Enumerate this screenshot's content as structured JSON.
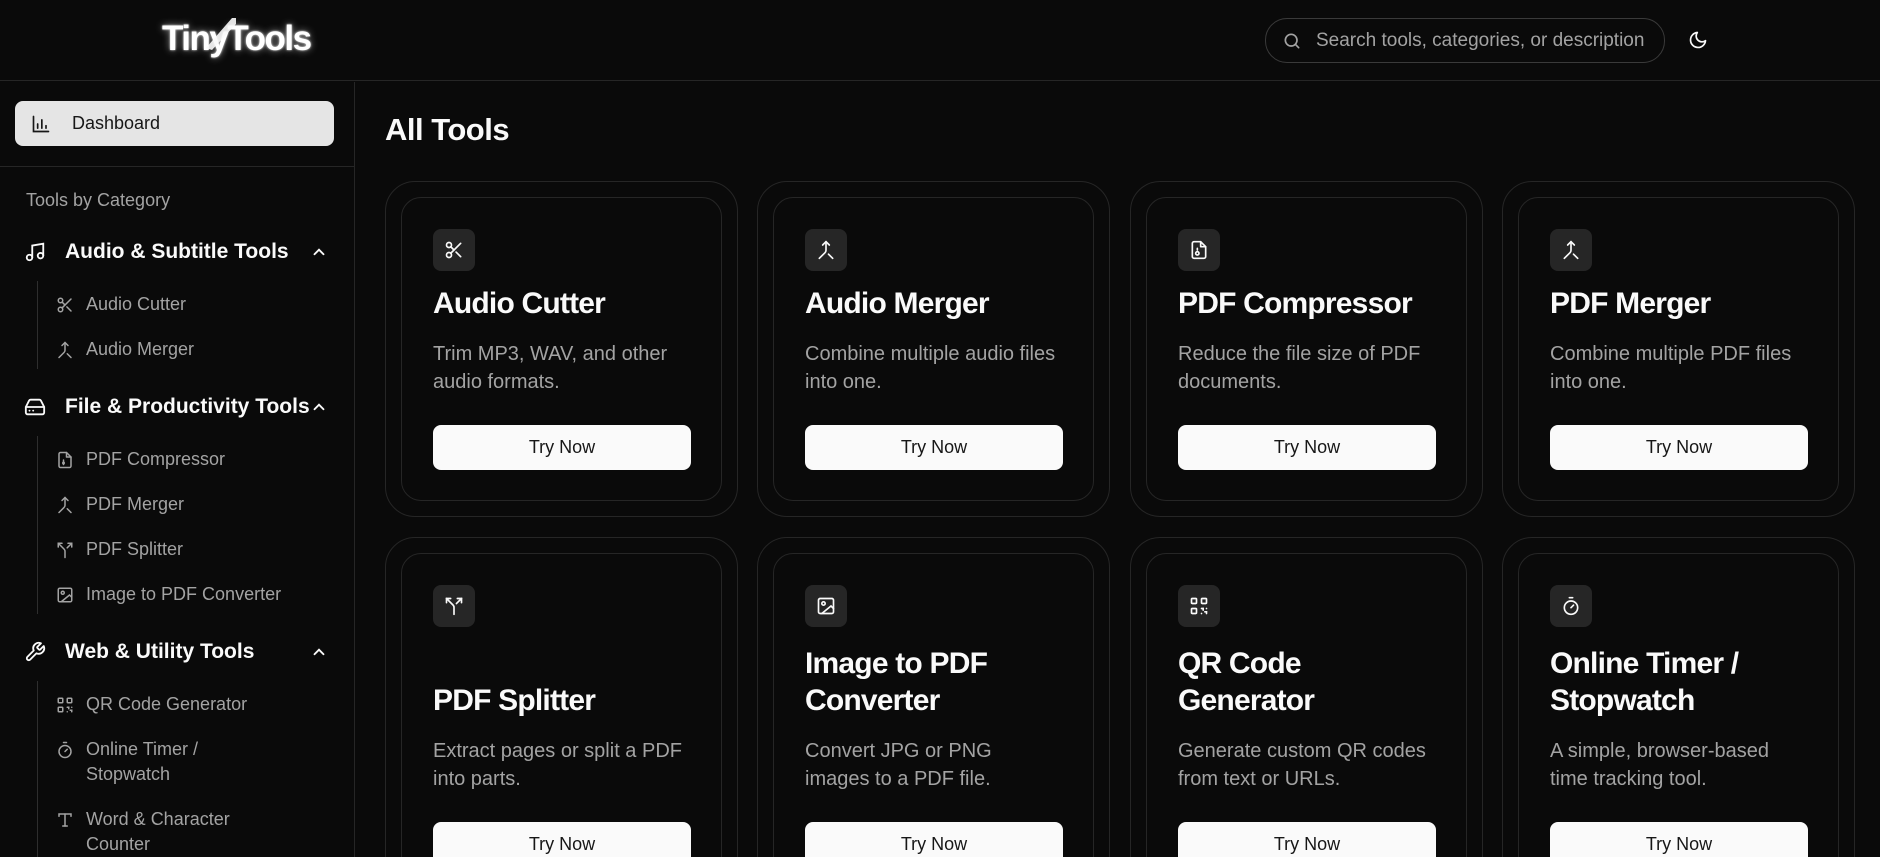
{
  "header": {
    "logo_part1": "Tiny",
    "logo_part2": "Tools",
    "search_placeholder": "Search tools, categories, or description",
    "theme_icon": "moon-icon"
  },
  "sidebar": {
    "dashboard_label": "Dashboard",
    "group_label": "Tools by Category",
    "categories": [
      {
        "label": "Audio & Subtitle Tools",
        "icon": "music-icon",
        "items": [
          {
            "label": "Audio Cutter",
            "icon": "scissors-icon"
          },
          {
            "label": "Audio Merger",
            "icon": "merge-icon"
          }
        ]
      },
      {
        "label": "File & Productivity Tools",
        "icon": "hard-drive-icon",
        "items": [
          {
            "label": "PDF Compressor",
            "icon": "file-archive-icon"
          },
          {
            "label": "PDF Merger",
            "icon": "merge-icon"
          },
          {
            "label": "PDF Splitter",
            "icon": "split-icon"
          },
          {
            "label": "Image to PDF Converter",
            "icon": "image-icon"
          }
        ]
      },
      {
        "label": "Web & Utility Tools",
        "icon": "wrench-icon",
        "items": [
          {
            "label": "QR Code Generator",
            "icon": "qr-code-icon"
          },
          {
            "label": "Online Timer / Stopwatch",
            "icon": "timer-icon"
          },
          {
            "label": "Word & Character Counter",
            "icon": "type-icon"
          }
        ]
      }
    ]
  },
  "main": {
    "title": "All Tools",
    "button_label": "Try Now",
    "cards": [
      {
        "title": "Audio Cutter",
        "desc": "Trim MP3, WAV, and other audio formats.",
        "icon": "scissors-icon"
      },
      {
        "title": "Audio Merger",
        "desc": "Combine multiple audio files into one.",
        "icon": "merge-icon"
      },
      {
        "title": "PDF Compressor",
        "desc": "Reduce the file size of PDF documents.",
        "icon": "file-archive-icon"
      },
      {
        "title": "PDF Merger",
        "desc": "Combine multiple PDF files into one.",
        "icon": "merge-icon"
      },
      {
        "title": "PDF Splitter",
        "desc": "Extract pages or split a PDF into parts.",
        "icon": "split-icon"
      },
      {
        "title": "Image to PDF Converter",
        "desc": "Convert JPG or PNG images to a PDF file.",
        "icon": "image-icon"
      },
      {
        "title": "QR Code Generator",
        "desc": "Generate custom QR codes from text or URLs.",
        "icon": "qr-code-icon"
      },
      {
        "title": "Online Timer / Stopwatch",
        "desc": "A simple, browser-based time tracking tool.",
        "icon": "timer-icon"
      }
    ]
  }
}
